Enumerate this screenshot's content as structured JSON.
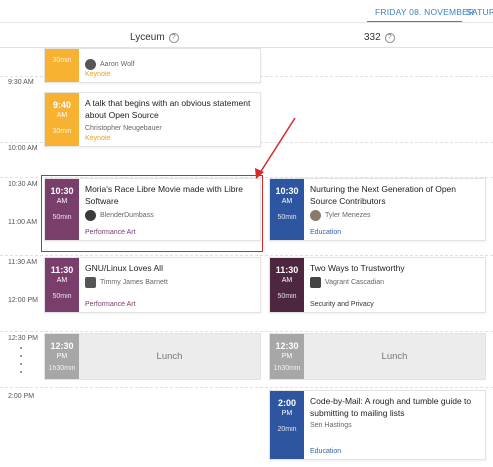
{
  "day_tabs": [
    {
      "label": "FRIDAY 08. NOVEMBER",
      "active": true
    },
    {
      "label": "SATURD",
      "active": false
    }
  ],
  "rooms": [
    {
      "name": "Lyceum",
      "help_icon": "help-circle-icon"
    },
    {
      "name": "332",
      "help_icon": "help-circle-icon"
    }
  ],
  "time_ticks": [
    "9:30 AM",
    "10:00 AM",
    "10:30 AM",
    "11:00 AM",
    "11:30 AM",
    "12:00 PM",
    "12:30 PM",
    "2:00 PM"
  ],
  "talks": [
    {
      "id": "prev",
      "room": "Lyceum",
      "time": "",
      "ampm": "",
      "duration": "30min",
      "title": "",
      "speaker": "Aaron Wolf",
      "track": "Keynote",
      "color": "#f6b230"
    },
    {
      "id": "obvious",
      "room": "Lyceum",
      "time": "9:40",
      "ampm": "AM",
      "duration": "30min",
      "title": "A talk that begins with an obvious statement about Open Source",
      "speaker": "Christopher Neugebauer",
      "track": "Keynote",
      "color": "#f6b230"
    },
    {
      "id": "moria",
      "room": "Lyceum",
      "time": "10:30",
      "ampm": "AM",
      "duration": "50min",
      "title": "Moria's Race Libre Movie made with Libre Software",
      "speaker": "BlenderDumbass",
      "track": "Performance Art",
      "color": "#7a3e6c"
    },
    {
      "id": "nurturing",
      "room": "332",
      "time": "10:30",
      "ampm": "AM",
      "duration": "50min",
      "title": "Nurturing the Next Generation of Open Source Contributors",
      "speaker": "Tyler Menezes",
      "track": "Education",
      "color": "#2e56a0"
    },
    {
      "id": "gnulinux",
      "room": "Lyceum",
      "time": "11:30",
      "ampm": "AM",
      "duration": "50min",
      "title": "GNU/Linux Loves All",
      "speaker": "Timmy James Barnett",
      "track": "Performance Art",
      "color": "#7a3e6c"
    },
    {
      "id": "trust",
      "room": "332",
      "time": "11:30",
      "ampm": "AM",
      "duration": "50min",
      "title": "Two Ways to Trustworthy",
      "speaker": "Vagrant Cascadian",
      "track": "Security and Privacy",
      "color": "#4d2740"
    },
    {
      "id": "mail",
      "room": "332",
      "time": "2:00",
      "ampm": "PM",
      "duration": "20min",
      "title": "Code-by-Mail: A rough and tumble guide to submitting to mailing lists",
      "speaker": "Sen Hastings",
      "track": "Education",
      "color": "#2e56a0"
    }
  ],
  "lunch": [
    {
      "room": "Lyceum",
      "time": "12:30",
      "ampm": "PM",
      "duration": "1h30min",
      "label": "Lunch"
    },
    {
      "room": "332",
      "time": "12:30",
      "ampm": "PM",
      "duration": "1h30min",
      "label": "Lunch"
    }
  ],
  "annotation": {
    "color": "#d62a2a"
  }
}
